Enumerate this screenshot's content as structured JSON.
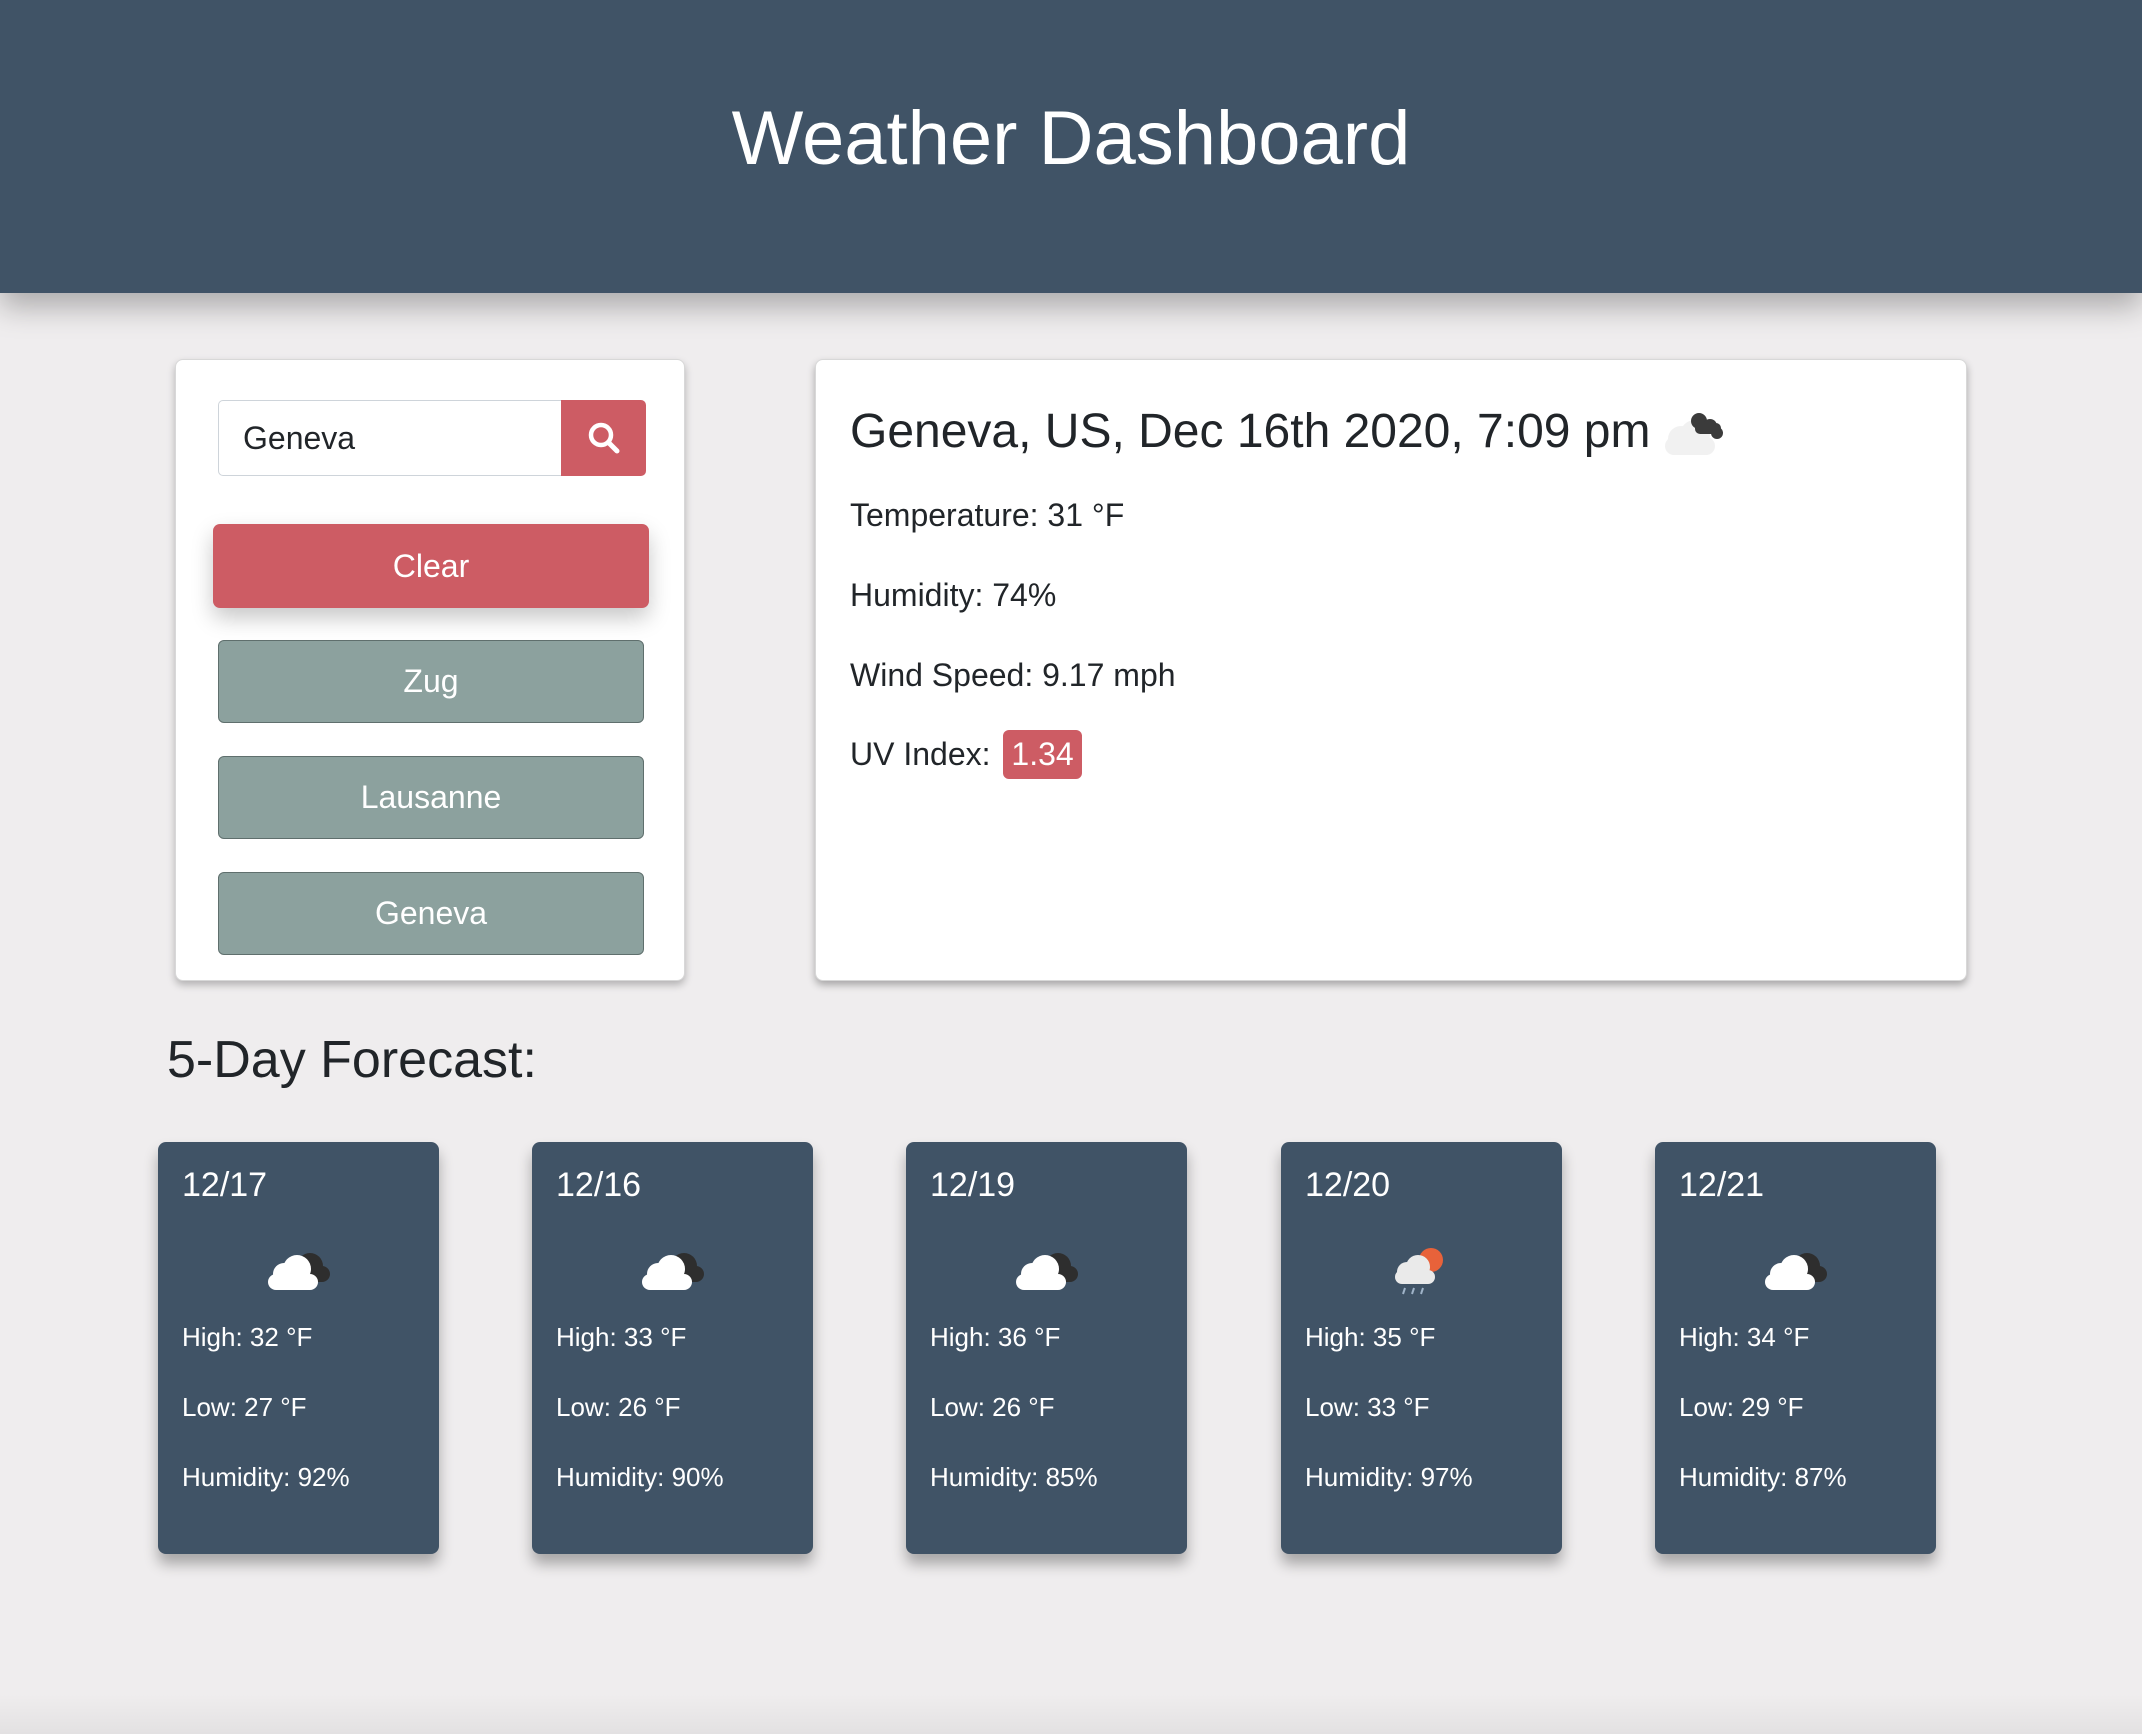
{
  "header": {
    "title": "Weather Dashboard"
  },
  "search": {
    "value": "Geneva",
    "button_icon": "search-icon",
    "clear_label": "Clear",
    "history": [
      "Zug",
      "Lausanne",
      "Geneva"
    ]
  },
  "current": {
    "title": "Geneva, US, Dec 16th 2020, 7:09 pm",
    "icon": "cloudy-night-icon",
    "temperature": "Temperature: 31 °F",
    "humidity": "Humidity: 74%",
    "wind": "Wind Speed: 9.17 mph",
    "uv_label": "UV Index:",
    "uv_value": "1.34"
  },
  "forecast": {
    "heading": "5-Day Forecast:",
    "days": [
      {
        "date": "12/17",
        "icon": "broken-clouds-icon",
        "high": "High: 32 °F",
        "low": "Low: 27 °F",
        "humidity": "Humidity: 92%"
      },
      {
        "date": "12/16",
        "icon": "broken-clouds-icon",
        "high": "High: 33 °F",
        "low": "Low: 26 °F",
        "humidity": "Humidity: 90%"
      },
      {
        "date": "12/19",
        "icon": "broken-clouds-icon",
        "high": "High: 36 °F",
        "low": "Low: 26 °F",
        "humidity": "Humidity: 85%"
      },
      {
        "date": "12/20",
        "icon": "rain-sun-icon",
        "high": "High: 35 °F",
        "low": "Low: 33 °F",
        "humidity": "Humidity: 97%"
      },
      {
        "date": "12/21",
        "icon": "broken-clouds-icon",
        "high": "High: 34 °F",
        "low": "Low: 29 °F",
        "humidity": "Humidity: 87%"
      }
    ]
  },
  "colors": {
    "header_bg": "#405366",
    "accent_red": "#cd5c64",
    "history_btn": "#8ca19e",
    "page_bg": "#efedee"
  }
}
